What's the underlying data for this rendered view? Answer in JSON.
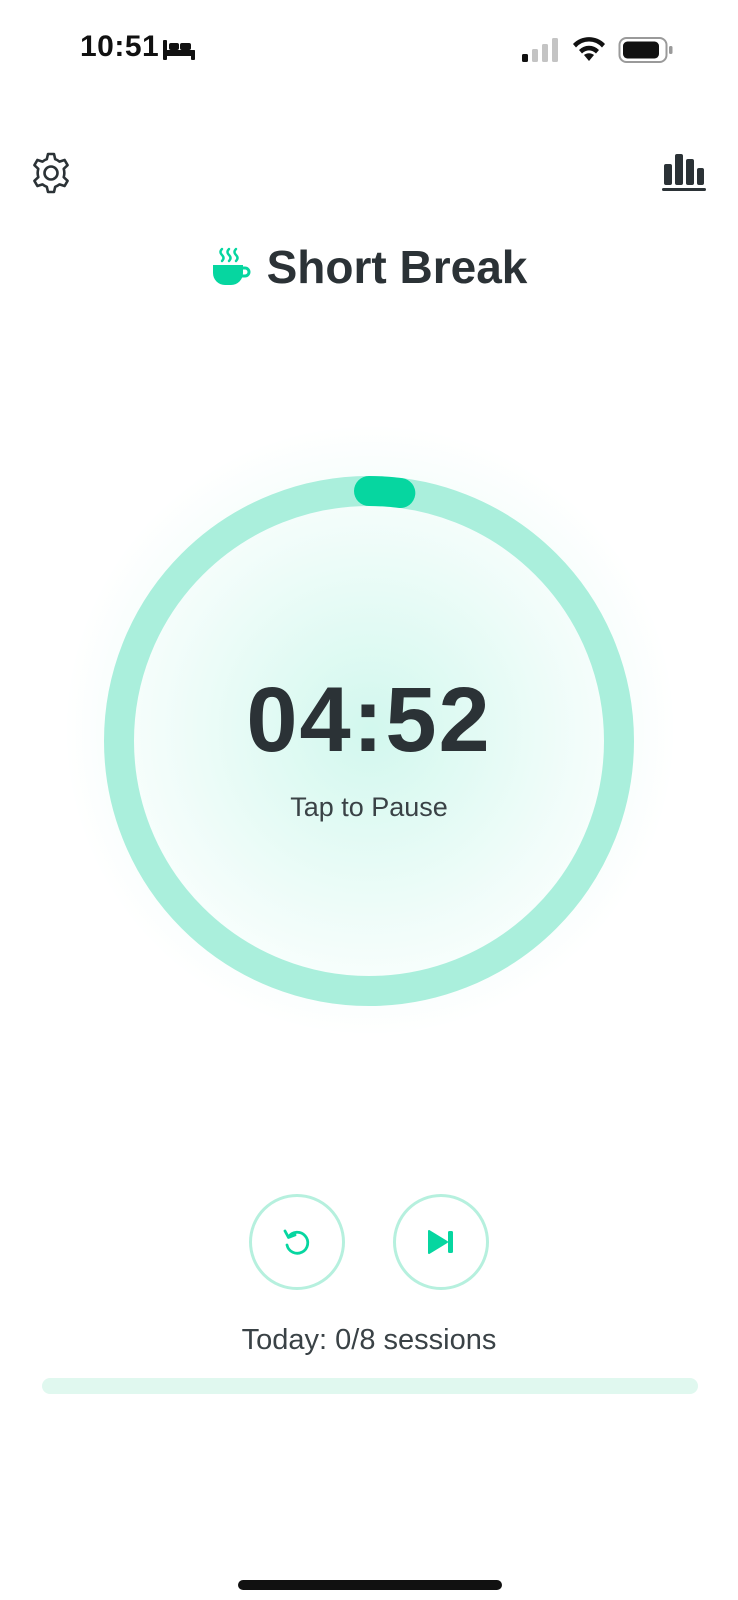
{
  "status_bar": {
    "time": "10:51",
    "icons": [
      "bed-icon",
      "signal-icon",
      "wifi-icon",
      "battery-icon"
    ]
  },
  "header": {
    "settings_icon": "gear-icon",
    "stats_icon": "bar-chart-icon"
  },
  "mode": {
    "icon": "hot-cup-icon",
    "title": "Short Break"
  },
  "timer": {
    "time": "04:52",
    "hint": "Tap to Pause",
    "elapsed_fraction": 0.02
  },
  "controls": {
    "reset_icon": "reset-icon",
    "skip_icon": "skip-next-icon"
  },
  "sessions": {
    "label": "Today: 0/8 sessions",
    "completed": 0,
    "total": 8
  },
  "colors": {
    "accent": "#06d6a0",
    "ring_track": "#aaefdc",
    "text": "#2b3236"
  }
}
